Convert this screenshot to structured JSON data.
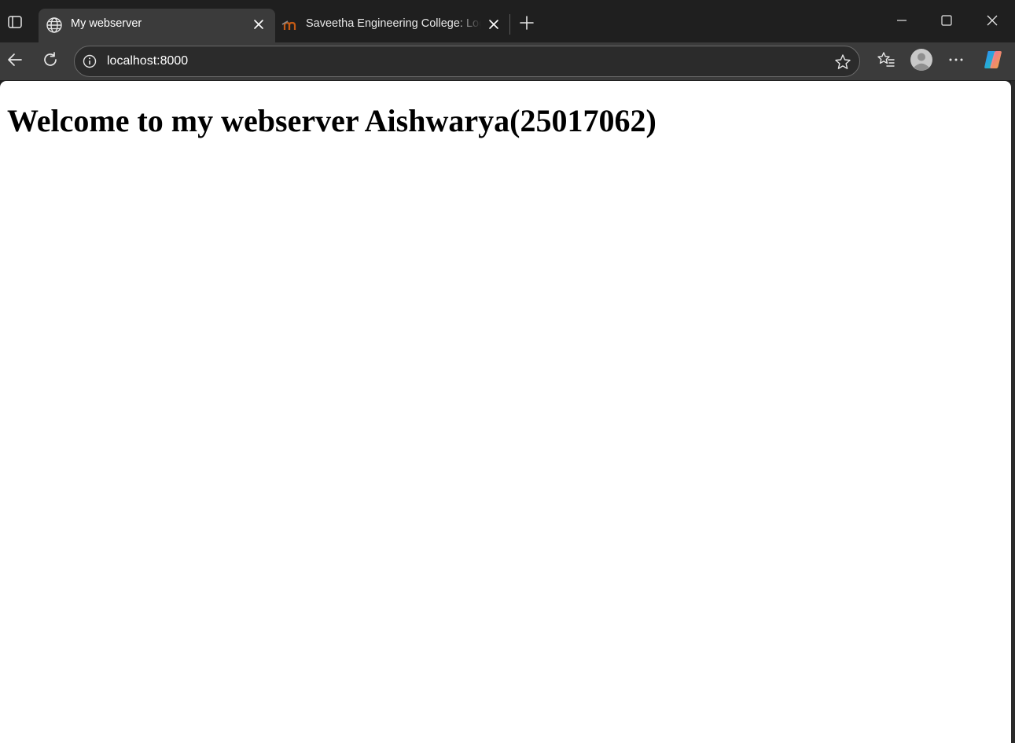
{
  "browser": {
    "tabs": [
      {
        "title": "My webserver",
        "active": true,
        "favicon": "globe-icon"
      },
      {
        "title": "Saveetha Engineering College: Log in to the site",
        "active": false,
        "favicon": "moodle-icon"
      }
    ],
    "address": {
      "url": "localhost:8000"
    },
    "icons": {
      "tab_actions": "tab-actions-icon",
      "new_tab": "plus-icon",
      "back": "back-arrow-icon",
      "reload": "reload-icon",
      "site_info": "info-icon",
      "favorite": "star-icon",
      "favorites": "favorites-icon",
      "profile": "avatar-icon",
      "more": "more-icon",
      "copilot": "copilot-icon"
    },
    "colors": {
      "tabstrip_bg": "#1f1f1f",
      "toolbar_bg": "#3b3b3b",
      "address_bg": "#2b2b2b",
      "page_bg": "#ffffff"
    }
  },
  "page": {
    "heading": "Welcome to my webserver Aishwarya(25017062)"
  }
}
